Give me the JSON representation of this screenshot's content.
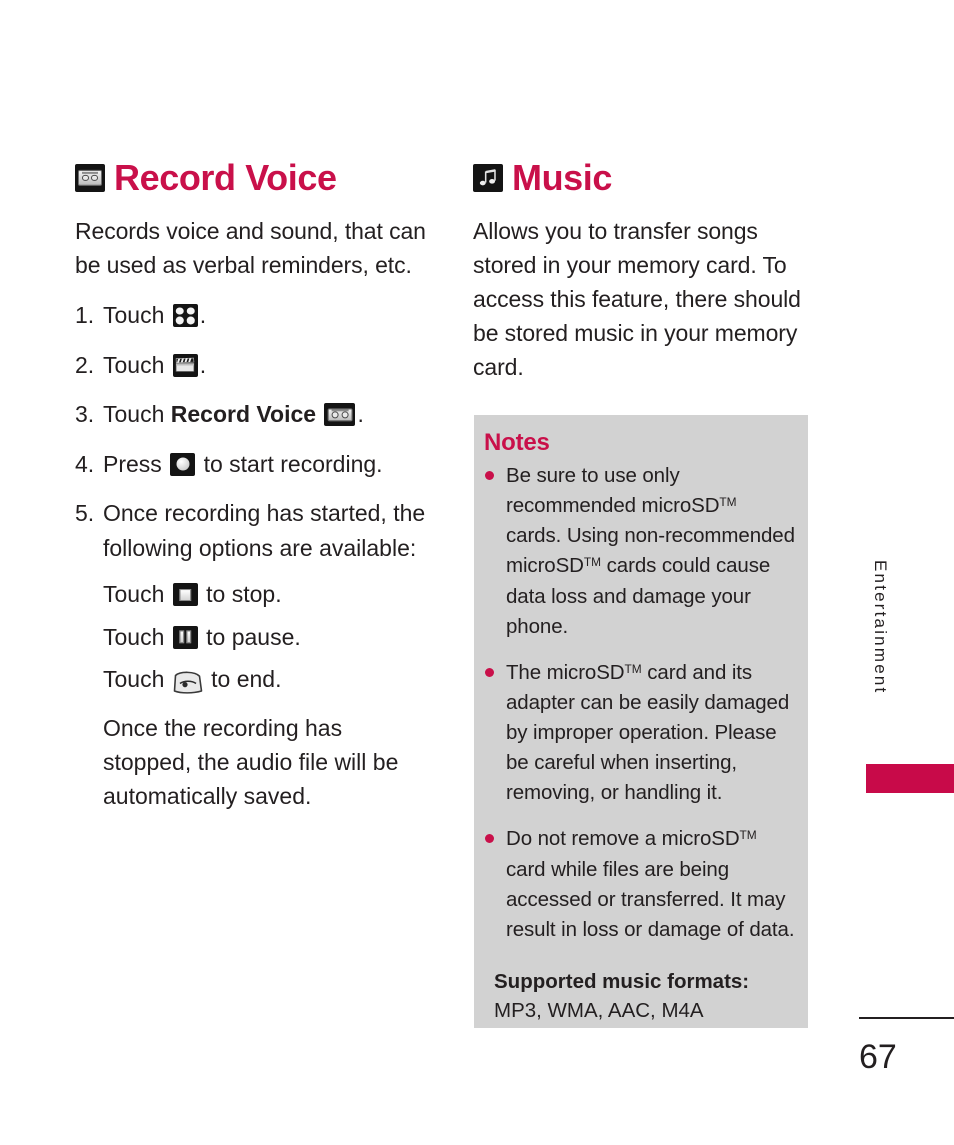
{
  "page": {
    "number": "67",
    "side_tab_label": "Entertainment",
    "accent_color": "#c9104a",
    "tab_block_color": "#c80a49",
    "notes_bg_color": "#d2d2d2"
  },
  "left_column": {
    "heading": "Record Voice",
    "heading_icon": "cassette-icon",
    "intro": "Records voice and sound, that can be used as verbal reminders, etc.",
    "steps": [
      {
        "num": "1.",
        "pre": "Touch",
        "icon": "four-dots-icon",
        "post": "."
      },
      {
        "num": "2.",
        "pre": "Touch",
        "icon": "clapperboard-icon",
        "post": "."
      },
      {
        "num": "3.",
        "pre": "Touch",
        "bold": "Record Voice",
        "icon": "cassette-icon",
        "post": "."
      },
      {
        "num": "4.",
        "pre": "Press",
        "icon": "record-button-icon",
        "post": "to start recording."
      },
      {
        "num": "5.",
        "pre": "Once recording has started, the following options are available:"
      }
    ],
    "sub_steps": [
      {
        "pre": "Touch",
        "icon": "stop-button-icon",
        "post": "to stop."
      },
      {
        "pre": "Touch",
        "icon": "pause-button-icon",
        "post": "to pause."
      },
      {
        "pre": "Touch",
        "icon": "end-call-icon",
        "post": "to end."
      }
    ],
    "closing": "Once the recording has stopped, the audio file will be automatically saved."
  },
  "right_column": {
    "heading": "Music",
    "heading_icon": "music-note-icon",
    "intro": "Allows you to transfer songs stored in your memory card. To access this feature, there should be stored music in your memory card.",
    "notes": {
      "title": "Notes",
      "items": [
        {
          "parts": [
            {
              "t": "Be sure to use only recommended microSD"
            },
            {
              "tm": true
            },
            {
              "t": " cards. Using non-recommended microSD"
            },
            {
              "tm": true
            },
            {
              "t": " cards could cause data loss and damage your phone."
            }
          ],
          "plain": "Be sure to use only recommended microSD™ cards. Using non-recommended microSD™ cards could cause data loss and damage your phone."
        },
        {
          "parts": [
            {
              "t": "The microSD"
            },
            {
              "tm": true
            },
            {
              "t": " card and its adapter can be easily damaged by improper operation. Please be careful when inserting, removing, or handling it."
            }
          ],
          "plain": "The microSD™ card and its adapter can be easily damaged by improper operation. Please be careful when inserting, removing, or handling it."
        },
        {
          "parts": [
            {
              "t": "Do not remove a microSD"
            },
            {
              "tm": true
            },
            {
              "t": " card while files are being accessed or transferred. It may result in loss or damage of data."
            }
          ],
          "plain": "Do not remove a microSD™ card while files are being accessed or transferred. It may result in loss or damage of data."
        }
      ],
      "formats_label": "Supported music formats:",
      "formats_value": "MP3, WMA, AAC, M4A"
    }
  }
}
